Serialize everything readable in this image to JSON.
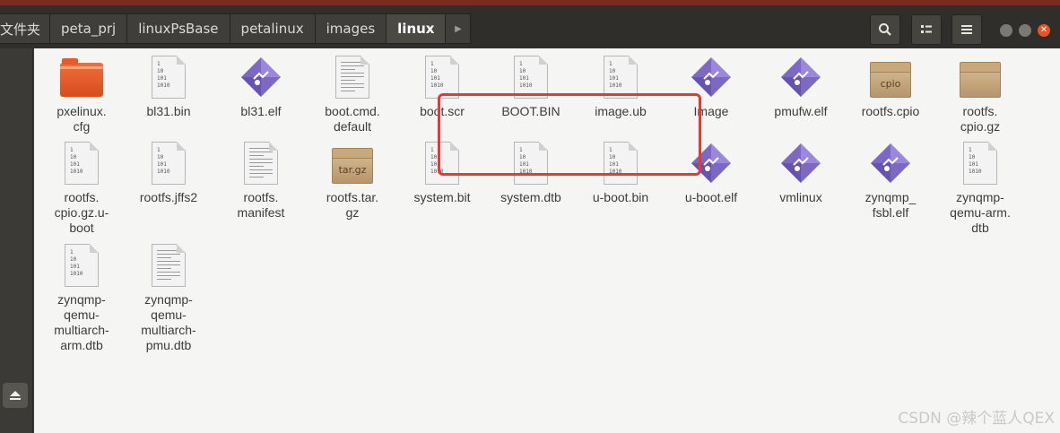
{
  "breadcrumbs": [
    "文件夹",
    "peta_prj",
    "linuxPsBase",
    "petalinux",
    "images",
    "linux"
  ],
  "header_buttons": {
    "search": "search-icon",
    "view": "list-view-icon",
    "menu": "hamburger-menu-icon"
  },
  "window_controls": [
    "minimize",
    "maximize",
    "close"
  ],
  "sidebar": {
    "eject": "eject-icon"
  },
  "files": [
    {
      "name": "pxelinux.\ncfg",
      "kind": "folder"
    },
    {
      "name": "bl31.bin",
      "kind": "binary"
    },
    {
      "name": "bl31.elf",
      "kind": "executable"
    },
    {
      "name": "boot.cmd.\ndefault",
      "kind": "text"
    },
    {
      "name": "boot.scr",
      "kind": "binary"
    },
    {
      "name": "BOOT.BIN",
      "kind": "binary"
    },
    {
      "name": "image.ub",
      "kind": "binary"
    },
    {
      "name": "Image",
      "kind": "executable"
    },
    {
      "name": "pmufw.elf",
      "kind": "executable"
    },
    {
      "name": "rootfs.cpio",
      "kind": "archive",
      "badge": "cpio"
    },
    {
      "name": "rootfs.\ncpio.gz",
      "kind": "archive",
      "badge": ""
    },
    {
      "name": "rootfs.\ncpio.gz.u-\nboot",
      "kind": "binary"
    },
    {
      "name": "rootfs.jffs2",
      "kind": "binary"
    },
    {
      "name": "rootfs.\nmanifest",
      "kind": "text"
    },
    {
      "name": "rootfs.tar.\ngz",
      "kind": "archive",
      "badge": "tar.gz"
    },
    {
      "name": "system.bit",
      "kind": "binary"
    },
    {
      "name": "system.dtb",
      "kind": "binary"
    },
    {
      "name": "u-boot.bin",
      "kind": "binary"
    },
    {
      "name": "u-boot.elf",
      "kind": "executable"
    },
    {
      "name": "vmlinux",
      "kind": "executable"
    },
    {
      "name": "zynqmp_\nfsbl.elf",
      "kind": "executable"
    },
    {
      "name": "zynqmp-\nqemu-arm.\ndtb",
      "kind": "binary"
    },
    {
      "name": "zynqmp-\nqemu-\nmultiarch-\narm.dtb",
      "kind": "binary"
    },
    {
      "name": "zynqmp-\nqemu-\nmultiarch-\npmu.dtb",
      "kind": "text"
    }
  ],
  "binary_icon_text": [
    "1",
    "10",
    "101",
    "1010"
  ],
  "watermark": "CSDN @辣个蓝人QEX",
  "colors": {
    "accent_red": "#e53935",
    "folder_orange": "#e85a28",
    "exec_purple": "#7d68c4"
  }
}
